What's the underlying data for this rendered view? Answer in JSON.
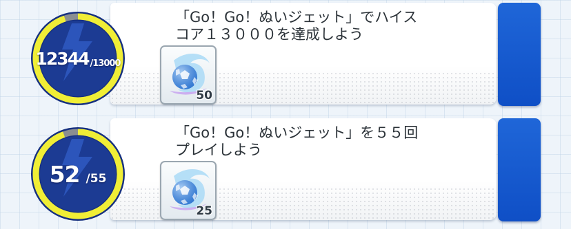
{
  "colors": {
    "ring_track": "#8a8e91",
    "ring_progress": "#f0ee36",
    "badge_fill": "#1c3b93",
    "action_tab": "#1559d3",
    "text": "#2b3238"
  },
  "missions": [
    {
      "progress": {
        "current": "12344",
        "target": "/13000",
        "fraction": 0.9495
      },
      "description": [
        "「Go！Go！ぬいジェット」でハイス",
        "コア１３０００を達成しよう"
      ],
      "reward": {
        "icon": "blue-soccer-ball-splash-icon",
        "quantity": "50"
      }
    },
    {
      "progress": {
        "current": "52",
        "target": "/55",
        "fraction": 0.9455
      },
      "description": [
        "「Go！Go！ぬいジェット」を５５回",
        "プレイしよう"
      ],
      "reward": {
        "icon": "blue-soccer-ball-splash-icon",
        "quantity": "25"
      }
    }
  ]
}
